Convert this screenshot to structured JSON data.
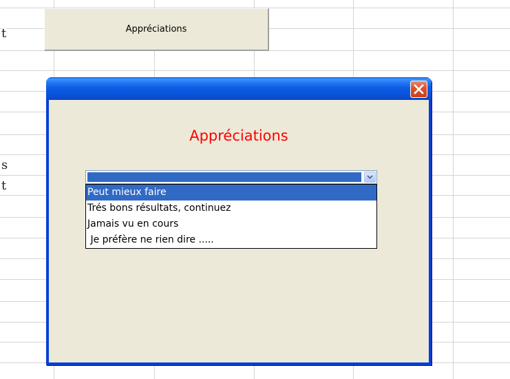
{
  "sheet": {
    "button_label": "Appréciations",
    "cell_fragments": [
      "t",
      "s",
      "t"
    ]
  },
  "dialog": {
    "heading": "Appréciations",
    "heading_color": "#ff0000",
    "title_text": "",
    "close_icon": "close-x-icon",
    "combo": {
      "current_value": "",
      "arrow_icon": "chevron-down-icon"
    },
    "options": [
      "Peut mieux faire",
      "Trés bons résultats, continuez",
      "Jamais vu en cours",
      " Je préfère ne rien dire ....."
    ],
    "selected_index": 0
  },
  "colors": {
    "titlebar": "#0a55dd",
    "client_bg": "#ece9d8",
    "selection": "#316ac5",
    "close_button": "#d8532c"
  }
}
